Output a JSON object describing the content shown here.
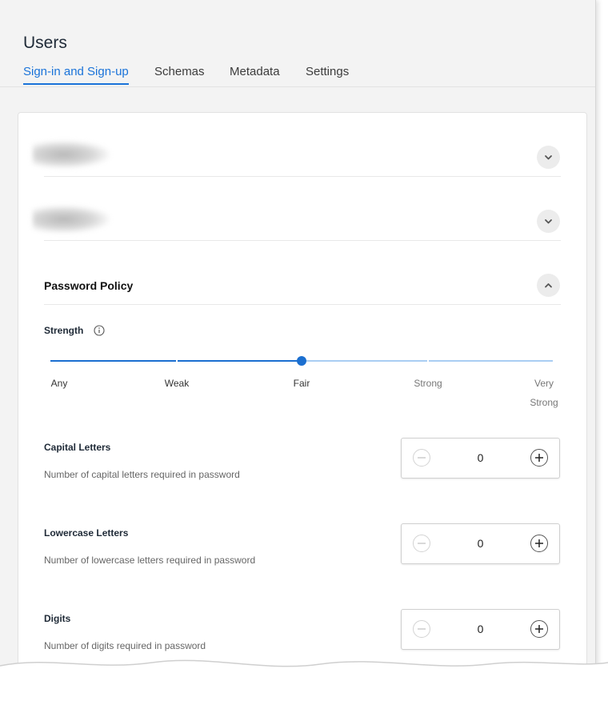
{
  "page": {
    "title": "Users"
  },
  "tabs": [
    {
      "label": "Sign-in and Sign-up",
      "active": true
    },
    {
      "label": "Schemas",
      "active": false
    },
    {
      "label": "Metadata",
      "active": false
    },
    {
      "label": "Settings",
      "active": false
    }
  ],
  "collapsed_sections": [
    {
      "icon": "chevron-down-icon"
    },
    {
      "icon": "chevron-down-icon"
    }
  ],
  "password_policy": {
    "title": "Password Policy",
    "toggle_icon": "chevron-up-icon",
    "strength": {
      "label": "Strength",
      "info_icon": "info-icon",
      "levels": [
        "Any",
        "Weak",
        "Fair",
        "Strong",
        "Very Strong"
      ],
      "selected": "Fair",
      "level_very_line1": "Very",
      "level_very_line2": "Strong"
    },
    "fields": [
      {
        "title": "Capital Letters",
        "description": "Number of capital letters required in password",
        "value": "0"
      },
      {
        "title": "Lowercase Letters",
        "description": "Number of lowercase letters required in password",
        "value": "0"
      },
      {
        "title": "Digits",
        "description": "Number of digits required in password",
        "value": "0"
      }
    ]
  },
  "colors": {
    "accent": "#1a73d9",
    "track_filled": "#1b6fd0",
    "track_empty": "#a9cdf3"
  }
}
